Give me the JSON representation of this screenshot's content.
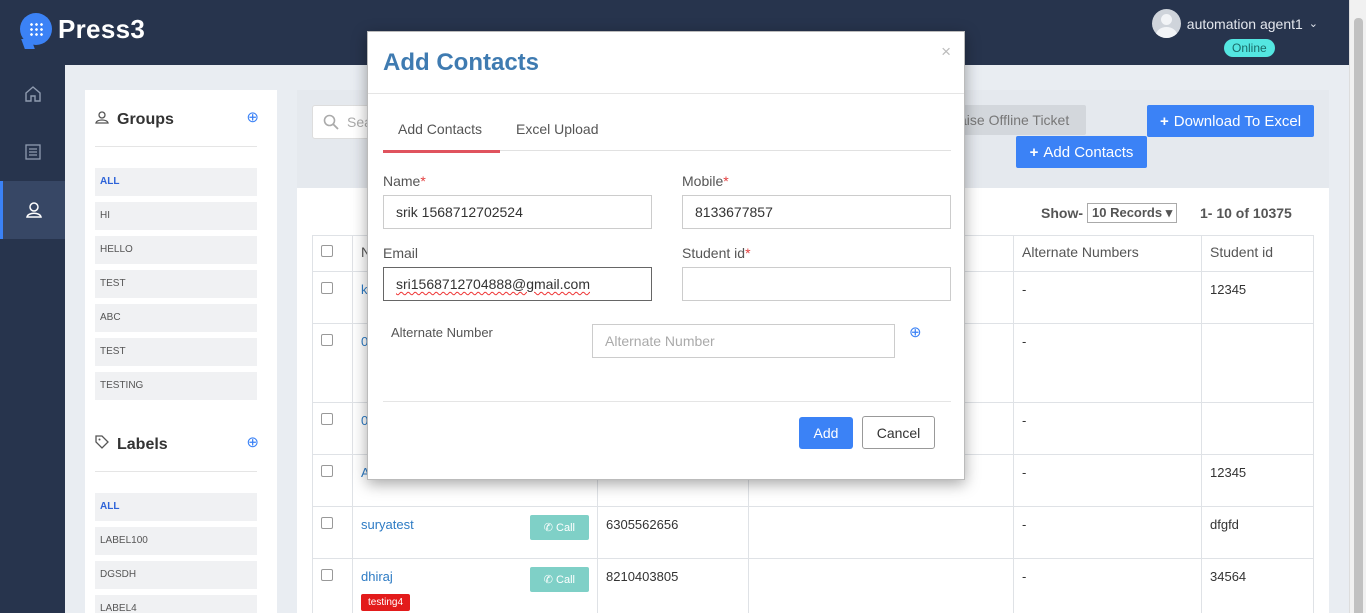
{
  "app": {
    "name": "Press3"
  },
  "user": {
    "name": "automation agent1",
    "status": "Online"
  },
  "nav": {
    "items": [
      "home-icon",
      "list-icon",
      "contacts-icon"
    ],
    "active": "contacts-icon"
  },
  "groups": {
    "title": "Groups",
    "items": [
      "ALL",
      "HI",
      "HELLO",
      "TEST",
      "ABC",
      "TEST",
      "TESTING"
    ]
  },
  "labels": {
    "title": "Labels",
    "items": [
      "ALL",
      "LABEL100",
      "DGSDH",
      "LABEL4"
    ]
  },
  "toolbar": {
    "search_placeholder": "Sea",
    "raise_ticket": "aise Offline Ticket",
    "download_excel": "Download To Excel",
    "add_contacts": "Add Contacts"
  },
  "pagination": {
    "show_label": "Show-",
    "records_select": "10 Records",
    "range": "1- 10 of 10375"
  },
  "table": {
    "headers": [
      "N",
      "Alternate Numbers",
      "Student id"
    ],
    "rows": [
      {
        "name": "k",
        "mobile": "",
        "alt": "-",
        "student_id": "12345"
      },
      {
        "name": "0",
        "mobile": "",
        "alt": "-",
        "student_id": ""
      },
      {
        "name": "0",
        "mobile": "",
        "alt": "-",
        "student_id": ""
      },
      {
        "name": "A",
        "mobile": "",
        "alt": "-",
        "student_id": "12345"
      },
      {
        "name": "suryatest",
        "mobile": "6305562656",
        "alt": "-",
        "student_id": "dfgfd",
        "call": "Call"
      },
      {
        "name": "dhiraj",
        "mobile": "8210403805",
        "alt": "-",
        "student_id": "34564",
        "call": "Call",
        "tag": "testing4"
      }
    ]
  },
  "modal": {
    "title": "Add Contacts",
    "close": "×",
    "tabs": [
      "Add Contacts",
      "Excel Upload"
    ],
    "name_label": "Name",
    "name_value": "srik 1568712702524",
    "mobile_label": "Mobile",
    "mobile_value": "8133677857",
    "email_label": "Email",
    "email_value": "sri1568712704888@gmail.com",
    "student_label": "Student id",
    "student_value": "",
    "alt_label": "Alternate Number",
    "alt_placeholder": "Alternate Number",
    "required_mark": "*",
    "add_button": "Add",
    "cancel_button": "Cancel"
  },
  "colors": {
    "primary": "#3b82f6",
    "nav": "#27344d",
    "title": "#3f7bb1",
    "tab_active": "#e0535e",
    "online": "#54e6e1"
  }
}
